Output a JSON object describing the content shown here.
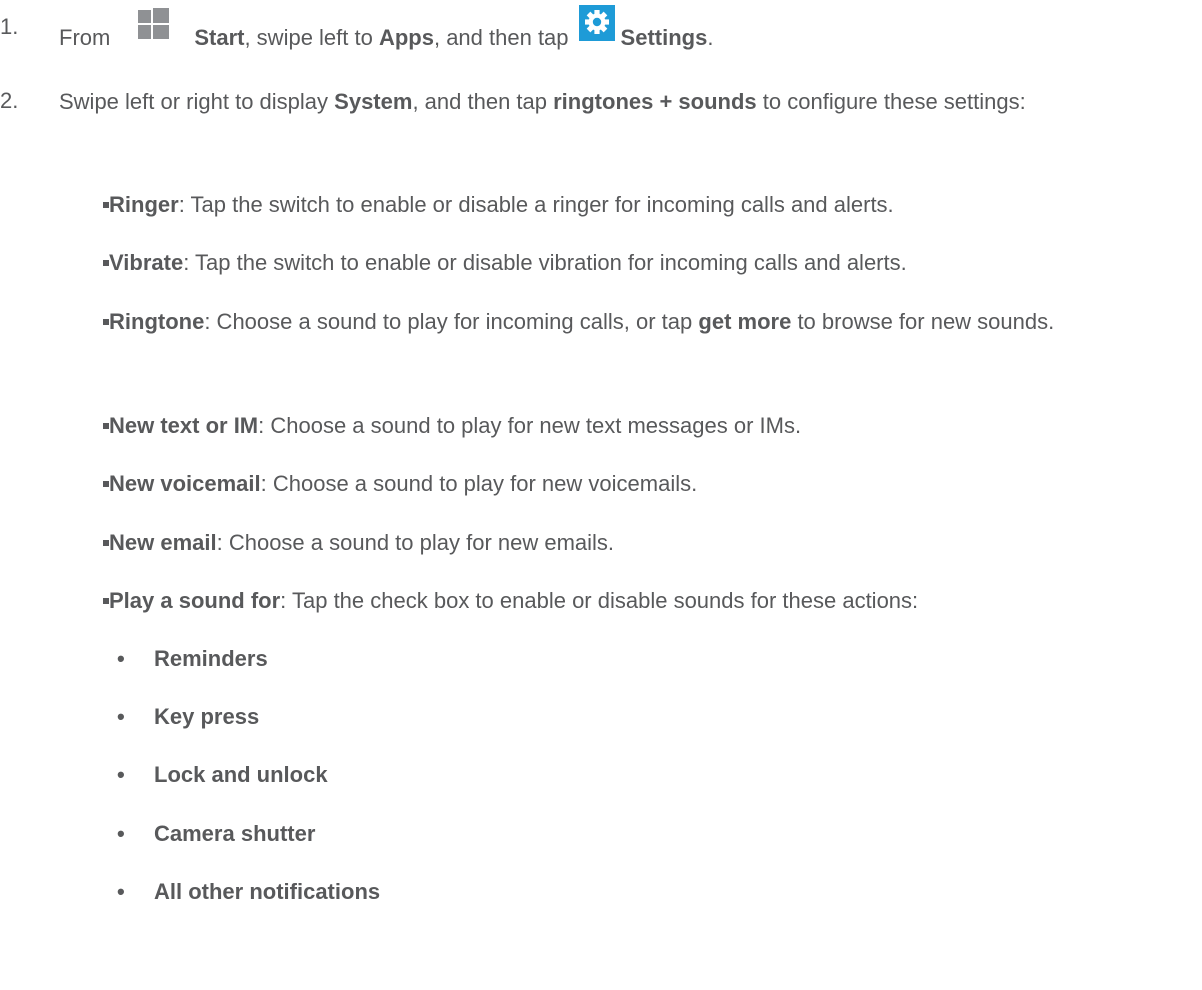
{
  "steps": [
    {
      "num": "1.",
      "parts": {
        "from": "From",
        "start": "Start",
        "mid": ", swipe left to",
        "apps": "Apps",
        "mid2": ", and then tap",
        "settings": "Settings",
        "end": "."
      }
    },
    {
      "num": "2.",
      "parts": {
        "pre": "Swipe left or right to display",
        "system": "System",
        "mid": ", and then tap",
        "ringtones": "ringtones + sounds",
        "post": "to configure these settings:"
      }
    }
  ],
  "settings_items": [
    {
      "term": "Ringer",
      "desc": ": Tap the switch to enable or disable a ringer for incoming calls and alerts."
    },
    {
      "term": "Vibrate",
      "desc": ": Tap the switch to enable or disable vibration for incoming calls and alerts."
    },
    {
      "term": "Ringtone",
      "desc": ": Choose a sound to play for incoming calls, or tap",
      "term2": "get more",
      "desc2": "to browse for new sounds."
    },
    {
      "term": "New text or IM",
      "desc": ": Choose a sound to play for new text messages or IMs."
    },
    {
      "term": "New voicemail",
      "desc": ": Choose a sound to play for new voicemails."
    },
    {
      "term": "New email",
      "desc": ": Choose a sound to play for new emails."
    },
    {
      "term": "Play a sound for",
      "desc": ": Tap the check box to enable or disable sounds for these actions:"
    }
  ],
  "sound_actions": [
    "Reminders",
    "Key press",
    "Lock and unlock",
    "Camera shutter",
    "All other notifications"
  ],
  "colors": {
    "text": "#58595b",
    "start_tile": "#8f9194",
    "settings_tile": "#1e9bd7"
  },
  "icons": {
    "start": "windows-start-icon",
    "settings": "settings-gear-icon"
  }
}
